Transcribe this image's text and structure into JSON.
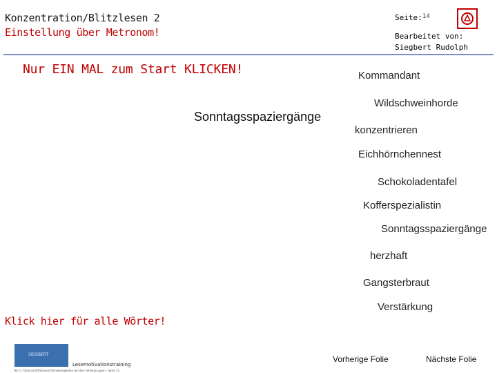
{
  "header": {
    "title": "Konzentration/Blitzlesen 2",
    "subtitle": "Einstellung über Metronom!",
    "page_label": "Seite:",
    "page_number": "14",
    "edited_by_label": "Bearbeitet von:",
    "edited_by_name": "Siegbert Rudolph"
  },
  "instruction": "Nur EIN MAL zum Start KLICKEN!",
  "overlap_text": "Sonntagsspaziergänge",
  "words": [
    "Kommandant",
    "Wildschweinhorde",
    "konzentrieren",
    "Eichhörnchennest",
    "Schokoladentafel",
    "Kofferspezialistin",
    "Sonntagsspaziergänge",
    "herzhaft",
    "Gangsterbraut",
    "Verstärkung"
  ],
  "click_all": "Klick hier für alle Wörter!",
  "footer": {
    "logo_text": "SIEGBERT",
    "program": "Lesemotivationstraining",
    "small_note": "Teil 1 - Überschrift/Vorwort/Schwierigkeiten bei den Fehlergruppen - Serie 11",
    "prev_label": "Vorherige Folie",
    "next_label": "Nächste Folie"
  },
  "colors": {
    "accent_red": "#c00000",
    "rule_blue": "#7a8ec4"
  }
}
